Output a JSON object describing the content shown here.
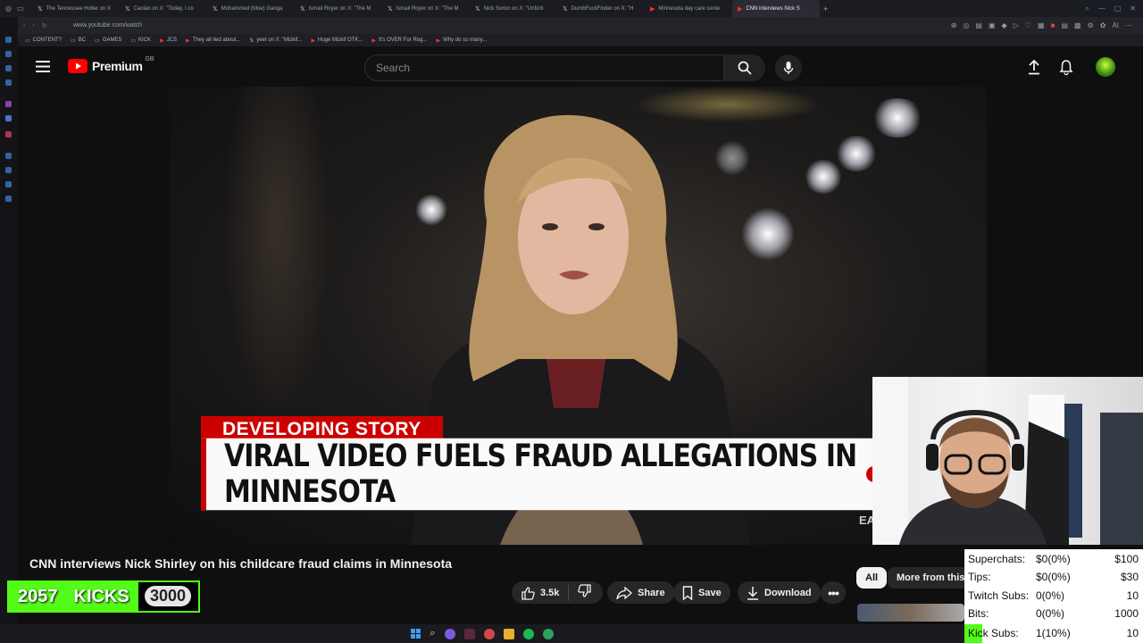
{
  "browser": {
    "tabs": [
      {
        "label": "The Tennessee Holler on X",
        "icon": "x-icon",
        "active": false
      },
      {
        "label": "Caolan on X: \"Today, I co",
        "icon": "x-icon",
        "active": false
      },
      {
        "label": "Mohammed (Moe) Ganga",
        "icon": "x-icon",
        "active": false
      },
      {
        "label": "Ismail Royer on X: \"The M",
        "icon": "x-icon",
        "active": false
      },
      {
        "label": "Ismail Royer on X: \"The M",
        "icon": "x-icon",
        "active": false
      },
      {
        "label": "Nick Sortor on X: \"Unforti",
        "icon": "x-icon",
        "active": false
      },
      {
        "label": "DumbFuckFinder on X: \"H",
        "icon": "x-icon",
        "active": false
      },
      {
        "label": "Minnesota day care cente",
        "icon": "youtube-icon",
        "active": false
      },
      {
        "label": "CNN interviews Nick S",
        "icon": "youtube-icon",
        "active": true
      }
    ],
    "url": "www.youtube.com/watch",
    "bookmarks": [
      {
        "label": "CONTENT?",
        "icon": "folder-icon"
      },
      {
        "label": "BC",
        "icon": "folder-icon"
      },
      {
        "label": "GAMES",
        "icon": "folder-icon"
      },
      {
        "label": "KICK",
        "icon": "folder-icon"
      },
      {
        "label": "JCS",
        "icon": "youtube-icon"
      },
      {
        "label": "They all lied about...",
        "icon": "youtube-icon"
      },
      {
        "label": "yeet on X: \"Mizkif...",
        "icon": "x-icon"
      },
      {
        "label": "Huge Mizkif OTK...",
        "icon": "youtube-icon"
      },
      {
        "label": "It's OVER For Rog...",
        "icon": "youtube-icon"
      },
      {
        "label": "Why do so many...",
        "icon": "youtube-icon"
      }
    ]
  },
  "masthead": {
    "logo_text": "Premium",
    "region": "GB",
    "search_placeholder": "Search"
  },
  "video": {
    "chyron_top": "DEVELOPING STORY",
    "chyron_main": "VIRAL VIDEO FUELS FRAUD ALLEGATIONS IN MINNESOTA",
    "corner_text": "EA"
  },
  "title": "CNN interviews Nick Shirley on his childcare fraud claims in Minnesota",
  "kicks": {
    "current": "2057",
    "label": "KICKS",
    "goal": "3000",
    "fill_fraction": 0.686
  },
  "actions": {
    "likes": "3.5k",
    "share": "Share",
    "save": "Save",
    "download": "Download"
  },
  "chips": [
    {
      "label": "All",
      "active": true
    },
    {
      "label": "More from this s",
      "active": false
    }
  ],
  "stats": [
    {
      "label": "Superchats:",
      "value": "$0(0%)",
      "goal": "$100"
    },
    {
      "label": "Tips:",
      "value": "$0(0%)",
      "goal": "$30"
    },
    {
      "label": "Twitch Subs:",
      "value": "0(0%)",
      "goal": "10"
    },
    {
      "label": "Bits:",
      "value": "0(0%)",
      "goal": "1000"
    },
    {
      "label": "Kick Subs:",
      "value": "1(10%)",
      "goal": "10"
    }
  ],
  "colors": {
    "youtube_red": "#ff0000",
    "cnn_red": "#cc0000",
    "kick_green": "#53fc18"
  }
}
